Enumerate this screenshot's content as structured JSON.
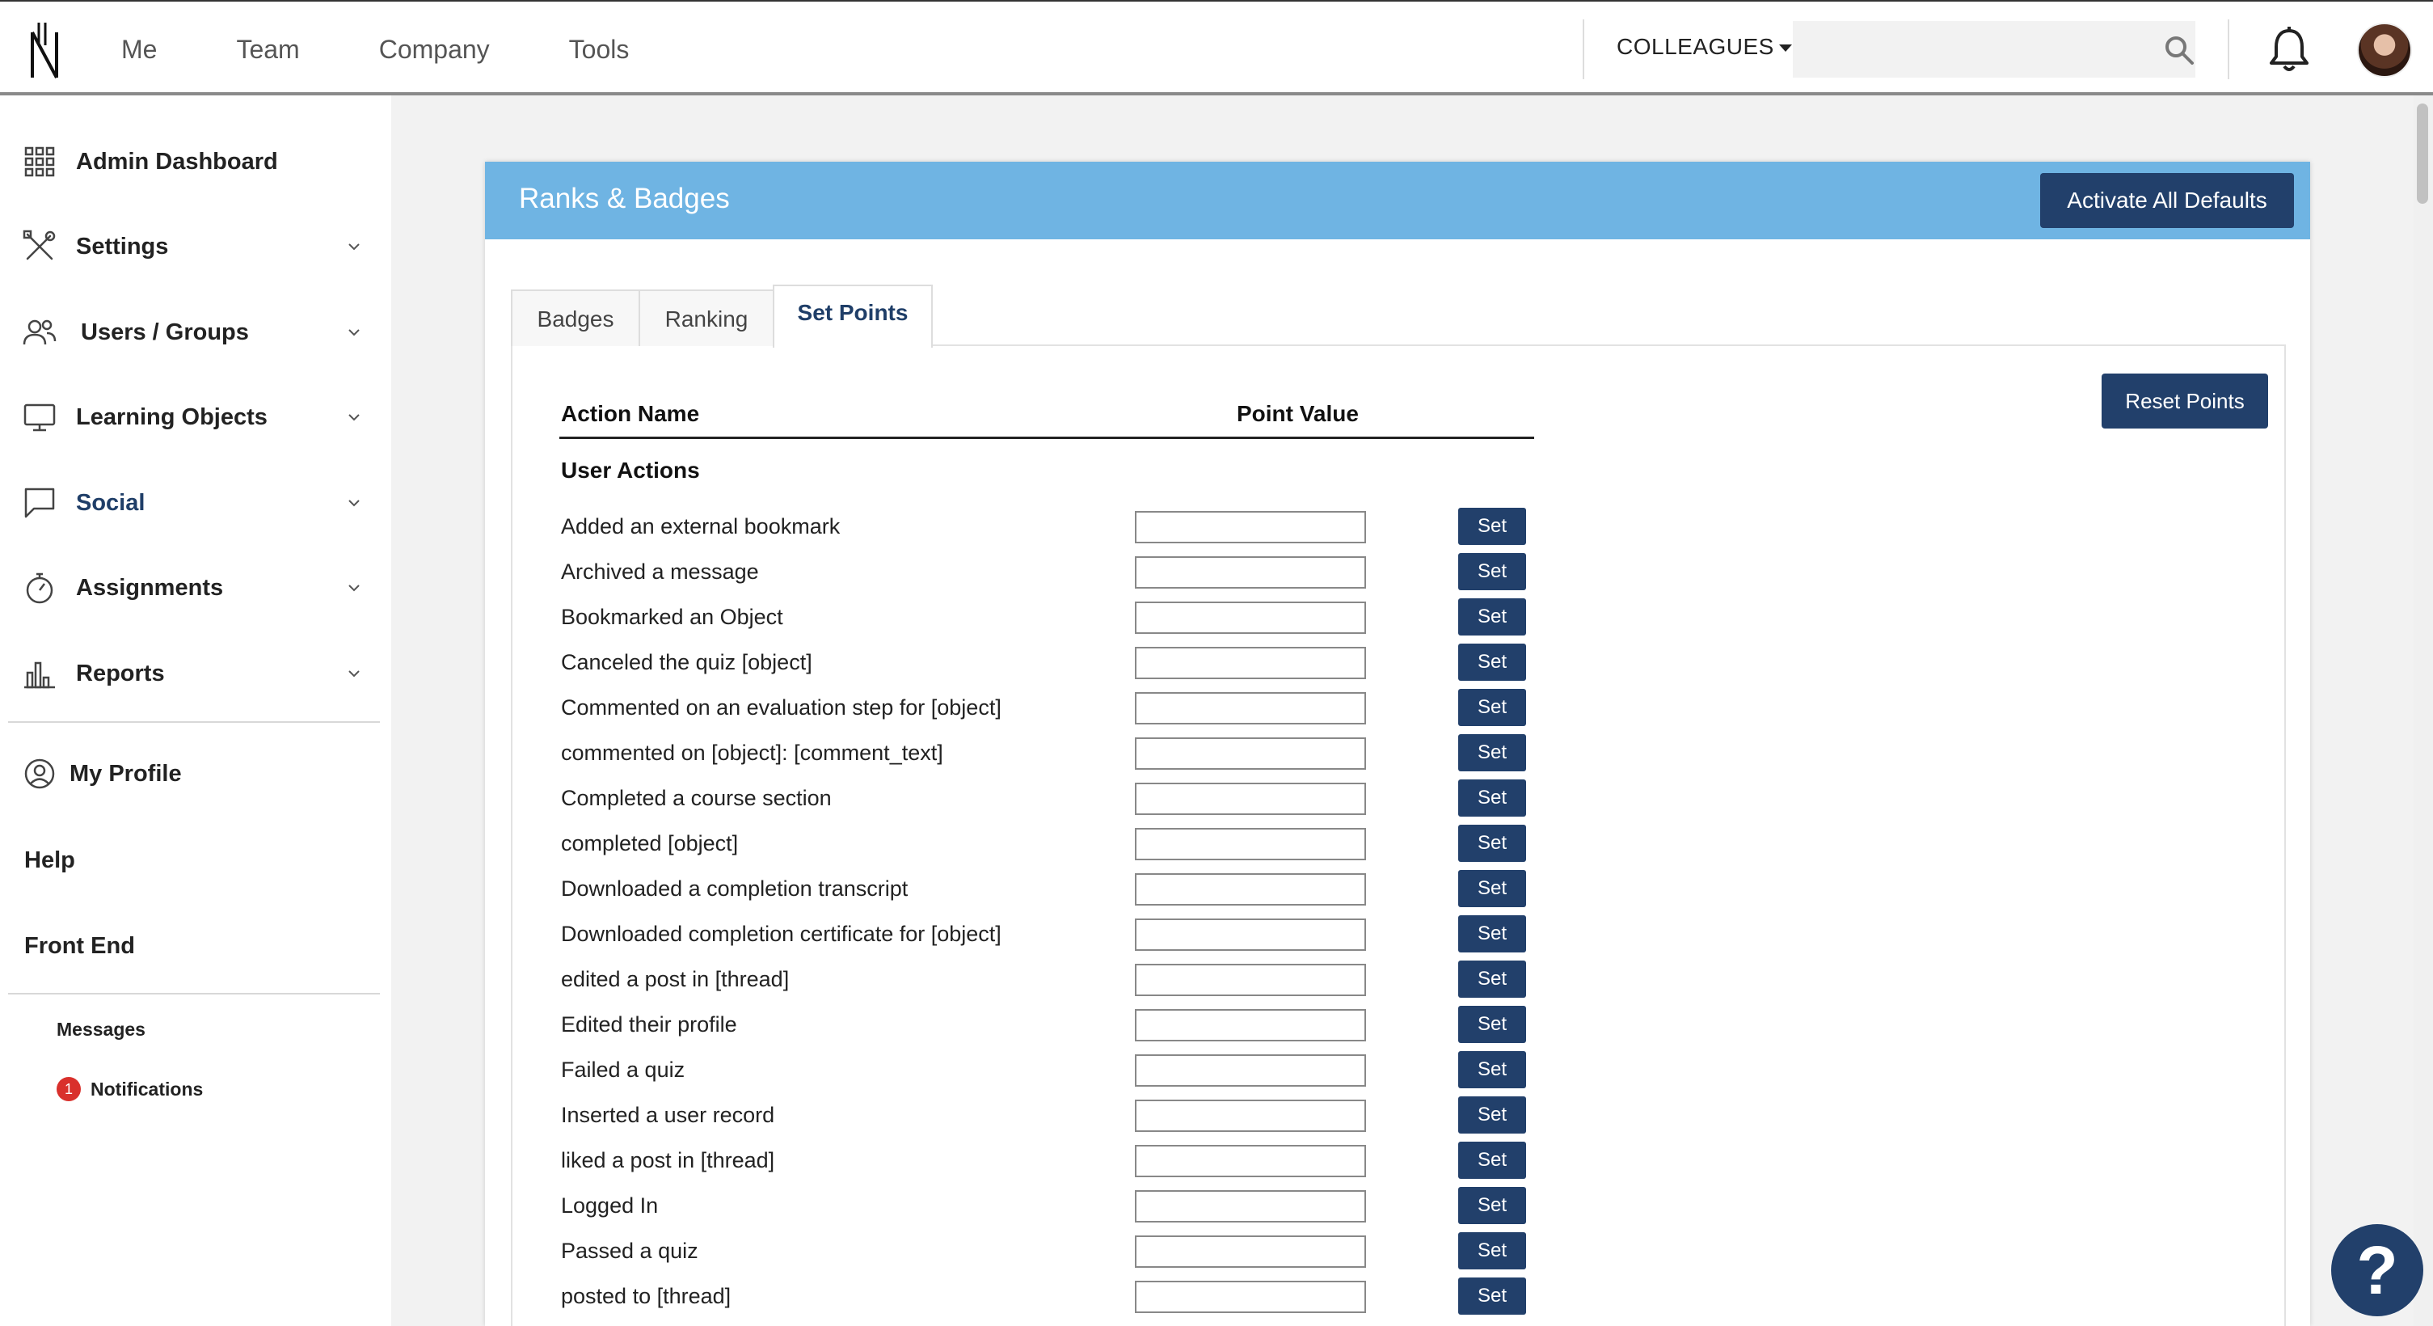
{
  "topbar": {
    "nav": [
      "Me",
      "Team",
      "Company",
      "Tools"
    ],
    "colleagues_label": "COLLEAGUES",
    "search_placeholder": ""
  },
  "sidebar": {
    "items": [
      {
        "label": "Admin Dashboard",
        "icon": "grid-icon",
        "expandable": false
      },
      {
        "label": "Settings",
        "icon": "tools-icon",
        "expandable": true
      },
      {
        "label": "Users / Groups",
        "icon": "users-icon",
        "expandable": true
      },
      {
        "label": "Learning Objects",
        "icon": "monitor-icon",
        "expandable": true
      },
      {
        "label": "Social",
        "icon": "chat-icon",
        "expandable": true
      },
      {
        "label": "Assignments",
        "icon": "stopwatch-icon",
        "expandable": true
      },
      {
        "label": "Reports",
        "icon": "bar-chart-icon",
        "expandable": true
      }
    ],
    "my_profile": "My Profile",
    "help": "Help",
    "front_end": "Front End",
    "messages": "Messages",
    "notifications": "Notifications",
    "notifications_count": "1"
  },
  "panel": {
    "title": "Ranks & Badges",
    "activate_button": "Activate All Defaults",
    "tabs": [
      "Badges",
      "Ranking",
      "Set Points"
    ],
    "active_tab": "Set Points",
    "reset_button": "Reset Points",
    "col_action": "Action Name",
    "col_points": "Point Value",
    "section": "User Actions",
    "set_label": "Set",
    "actions": [
      "Added an external bookmark",
      "Archived a message",
      "Bookmarked an Object",
      "Canceled the quiz [object]",
      "Commented on an evaluation step for [object]",
      "commented on [object]: [comment_text]",
      "Completed a course section",
      "completed [object]",
      "Downloaded a completion transcript",
      "Downloaded completion certificate for [object]",
      "edited a post in [thread]",
      "Edited their profile",
      "Failed a quiz",
      "Inserted a user record",
      "liked a post in [thread]",
      "Logged In",
      "Passed a quiz",
      "posted to [thread]"
    ]
  },
  "help_fab": "?",
  "colors": {
    "header_blue": "#6fb4e3",
    "button_navy": "#22406b",
    "badge_red": "#d9302c"
  }
}
